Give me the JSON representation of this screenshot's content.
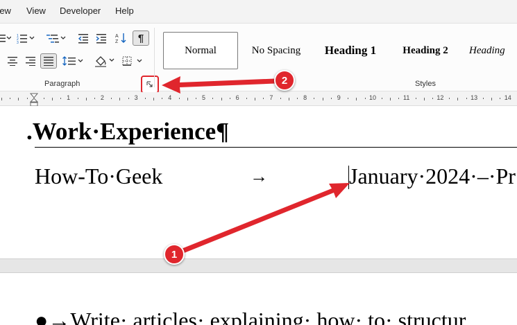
{
  "menu": {
    "view": "View",
    "developer": "Developer",
    "help": "Help"
  },
  "ribbon": {
    "paragraph_label": "Paragraph",
    "styles_label": "Styles",
    "styles": [
      "Normal",
      "No Spacing",
      "Heading 1",
      "Heading 2",
      "Heading"
    ]
  },
  "ruler": {
    "numbers": [
      "1",
      "2",
      "3",
      "4",
      "5",
      "6",
      "7",
      "8",
      "9",
      "10",
      "11",
      "12",
      "13",
      "14"
    ]
  },
  "document": {
    "heading": ".Work·Experience¶",
    "company": "How-To·Geek",
    "tab_arrow": "→",
    "date": "January·2024·–·Pr",
    "bullet": "●→Write· articles· explaining· how· to· structur"
  },
  "annotations": {
    "badge1": "1",
    "badge2": "2",
    "color": "#e0262d"
  },
  "icons": [
    "bullets-icon",
    "numbering-icon",
    "multilevel-list-icon",
    "decrease-indent-icon",
    "increase-indent-icon",
    "sort-icon",
    "show-formatting-icon",
    "align-center-icon",
    "align-right-icon",
    "justify-icon",
    "line-spacing-icon",
    "shading-icon",
    "borders-icon",
    "dialog-launcher-icon",
    "indent-marker-icon"
  ]
}
